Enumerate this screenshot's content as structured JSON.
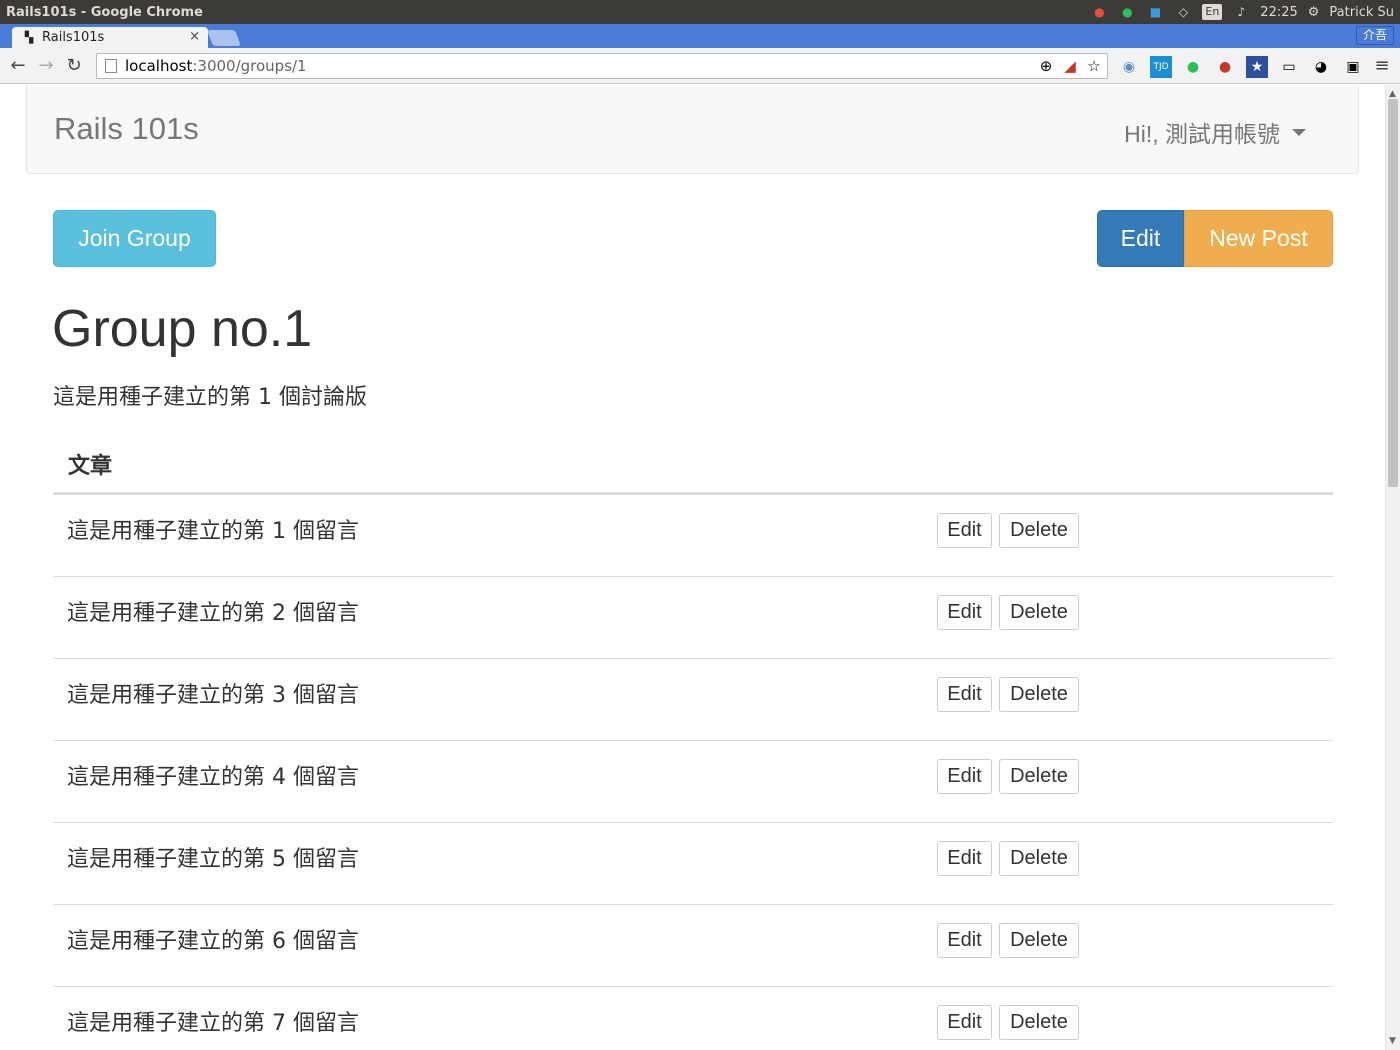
{
  "os": {
    "window_title": "Rails101s - Google Chrome",
    "lang": "En",
    "time": "22:25",
    "user": "Patrick Su"
  },
  "browser": {
    "tab_title": "Rails101s",
    "profile_label": "介吾",
    "url_host": "localhost",
    "url_path": ":3000/groups/1"
  },
  "navbar": {
    "brand": "Rails 101s",
    "user_greeting": "Hi!, 測試用帳號"
  },
  "actions": {
    "join_label": "Join Group",
    "edit_label": "Edit",
    "new_post_label": "New Post"
  },
  "group": {
    "title": "Group no.1",
    "description": "這是用種子建立的第 1 個討論版"
  },
  "posts_table": {
    "header": "文章",
    "rows": [
      {
        "title": "這是用種子建立的第 1 個留言",
        "edit": "Edit",
        "delete": "Delete"
      },
      {
        "title": "這是用種子建立的第 2 個留言",
        "edit": "Edit",
        "delete": "Delete"
      },
      {
        "title": "這是用種子建立的第 3 個留言",
        "edit": "Edit",
        "delete": "Delete"
      },
      {
        "title": "這是用種子建立的第 4 個留言",
        "edit": "Edit",
        "delete": "Delete"
      },
      {
        "title": "這是用種子建立的第 5 個留言",
        "edit": "Edit",
        "delete": "Delete"
      },
      {
        "title": "這是用種子建立的第 6 個留言",
        "edit": "Edit",
        "delete": "Delete"
      },
      {
        "title": "這是用種子建立的第 7 個留言",
        "edit": "Edit",
        "delete": "Delete"
      }
    ]
  },
  "colors": {
    "info": "#5bc0de",
    "primary": "#337ab7",
    "warning": "#f0ad4e",
    "chrome_tabbar": "#4a7bd8",
    "ubuntu_panel": "#3c3b37"
  }
}
